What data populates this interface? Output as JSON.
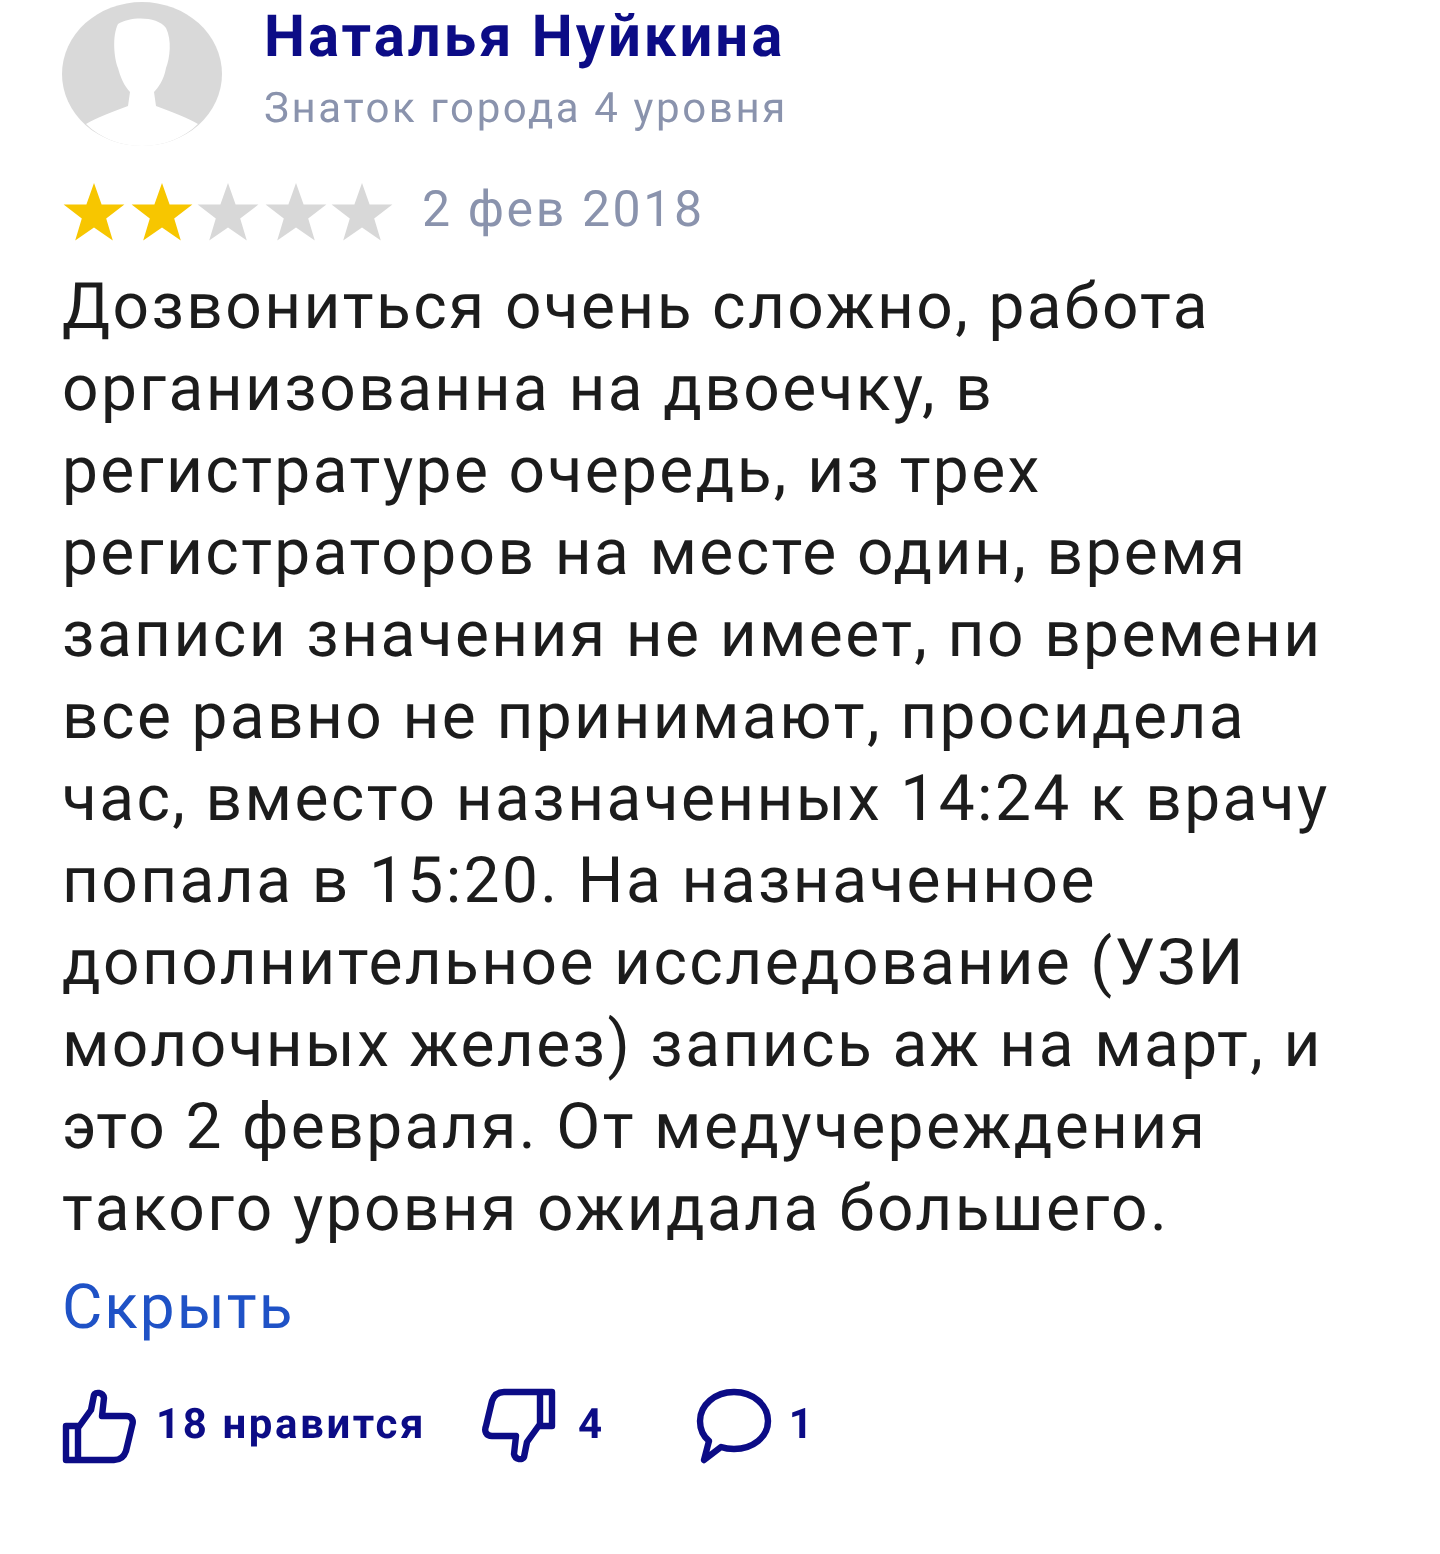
{
  "review": {
    "author": {
      "name": "Наталья Нуйкина",
      "level": "Знаток города 4 уровня"
    },
    "stars": 2,
    "date": "2 фев 2018",
    "text_lines": [
      "Дозвониться очень сложно, работа",
      "организованна на двоечку, в",
      "регистратуре очередь, из трех",
      "регистраторов на месте один, время",
      "записи значения не имеет, по времени",
      "все равно не принимают, просидела",
      "час, вместо назначенных 14:24 к врачу",
      "попала в 15:20. На назначенное",
      "дополнительное исследование (УЗИ",
      "молочных желез) запись аж на март, и",
      "это 2 февраля. От медучереждения",
      "такого уровня ожидала большего."
    ],
    "collapse_link": "Скрыть",
    "actions": [
      {
        "kind": "like",
        "label": "18 нравится"
      },
      {
        "kind": "dislike",
        "label": "4"
      },
      {
        "kind": "comment",
        "label": "1"
      }
    ]
  }
}
